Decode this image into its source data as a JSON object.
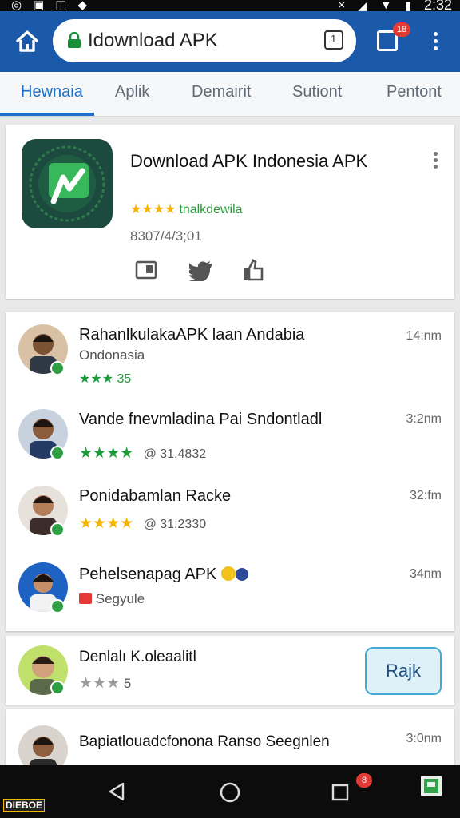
{
  "status": {
    "time": "2:32"
  },
  "browser": {
    "url": "Idownload APK",
    "tab_count": "1",
    "notif_count": "18"
  },
  "tabs": [
    {
      "label": "Hewnaia"
    },
    {
      "label": "Aplik"
    },
    {
      "label": "Demairit"
    },
    {
      "label": "Sutiont"
    },
    {
      "label": "Pentont"
    }
  ],
  "app": {
    "title": "Download APK Indonesia APK",
    "stars": "★★★★",
    "rating_text": "tnalkdewila",
    "size": "8307/4/3;01",
    "icon_colors": {
      "bg": "#1c4a3e",
      "accent": "#2fb052"
    }
  },
  "reviews": [
    {
      "name": "RahanlkulakaAPK laan Andabia",
      "sub": "Ondonasia",
      "stars": "★★★",
      "count": "35",
      "time": "14:nm"
    },
    {
      "name": "Vande fnevmladina Pai Sndontladl",
      "stars": "★★★★",
      "meta": "@ 31.4832",
      "time": "3:2nm"
    },
    {
      "name": "Ponidabamlan Racke",
      "stars": "★★★★",
      "meta": "@ 31:2330",
      "time": "32:fm"
    },
    {
      "name": "Pehelsenapag APK",
      "sub": "Segyule",
      "time": "34nm"
    }
  ],
  "rate_card": {
    "name": "Denlalı K.oleaalitl",
    "stars": "★★★",
    "count": "5",
    "button": "Rajk"
  },
  "last_review": {
    "name": "Bapiatlouadcfonona Ranso Seegnlen",
    "time": "3:0nm"
  },
  "navbar": {
    "badge": "8",
    "logo": "DIEBOE"
  },
  "colors": {
    "appbar": "#1b59ab",
    "accent": "#1b6fc7",
    "green": "#1a9b38",
    "gold": "#f4b400"
  }
}
